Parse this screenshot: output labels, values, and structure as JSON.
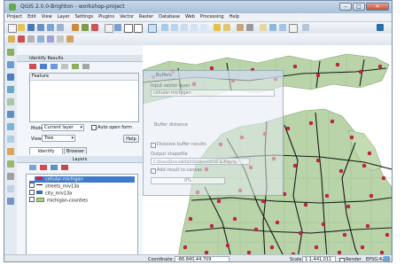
{
  "window": {
    "title": "QGIS 2.0.0-Brighton - workshop-project",
    "minimize": "–",
    "maximize": "□",
    "close": "✕"
  },
  "menu": [
    "Project",
    "Edit",
    "View",
    "Layer",
    "Settings",
    "Plugins",
    "Vector",
    "Raster",
    "Database",
    "Web",
    "Processing",
    "Help"
  ],
  "identify_panel": {
    "title": "Identify Results",
    "column_header": "Feature",
    "mode_label": "Mode",
    "mode_value": "Current layer",
    "auto_open_label": "Auto open form",
    "view_label": "View",
    "view_value": "Tree",
    "help_button": "Help",
    "tabs": [
      "Identify Results",
      "Browser"
    ]
  },
  "layers_panel": {
    "title": "Layers",
    "layers": [
      {
        "name": "cellular-michigan",
        "color": "#cc2244",
        "selected": true
      },
      {
        "name": "streets_miv13a",
        "color": "#111111",
        "selected": false
      },
      {
        "name": "city_miv13a",
        "color": "#3a6ea5",
        "selected": false
      },
      {
        "name": "michigan-counties",
        "color": "#a9d08e",
        "selected": false
      }
    ]
  },
  "dialog": {
    "title": "Buffers",
    "input_label": "Input vector layer",
    "input_value": "cellular-michigan",
    "buffer_label": "Buffer distance",
    "dissolve_label": "Dissolve buffer results",
    "output_label": "Output shapefile",
    "output_value": "C:/Users/DennisB/QGIS/Datasets/cell-buffer.shp",
    "add_result_label": "Add result to canvas",
    "progress": 0.0,
    "progress_text": "0%"
  },
  "statusbar": {
    "coordinate_label": "Coordinate:",
    "coordinate_value": "-86.840,44.709",
    "scale_label": "Scale",
    "scale_value": "1:1,441,011",
    "render_label": "Render",
    "crs": "EPSG:4269"
  },
  "colors": {
    "land": "#b8d4a8",
    "points": "#d61f48",
    "roads": "#1a1a1a",
    "water": "#ffffff"
  }
}
